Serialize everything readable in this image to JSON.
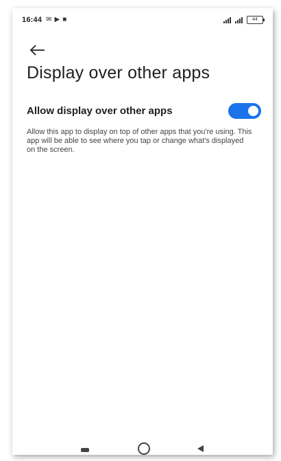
{
  "status_bar": {
    "time": "16:44",
    "icons": [
      "mail-icon",
      "play-icon",
      "video-icon"
    ],
    "battery_level": "44"
  },
  "header": {
    "back_icon": "arrow-back-icon",
    "title": "Display over other apps"
  },
  "setting": {
    "label": "Allow display over other apps",
    "enabled": true,
    "accent_color": "#1a73e8"
  },
  "description": "Allow this app to display on top of other apps that you're using. This app will be able to see where you tap or change what's displayed on the screen.",
  "nav_bar": {
    "icons": [
      "recents-icon",
      "home-icon",
      "back-icon"
    ]
  }
}
